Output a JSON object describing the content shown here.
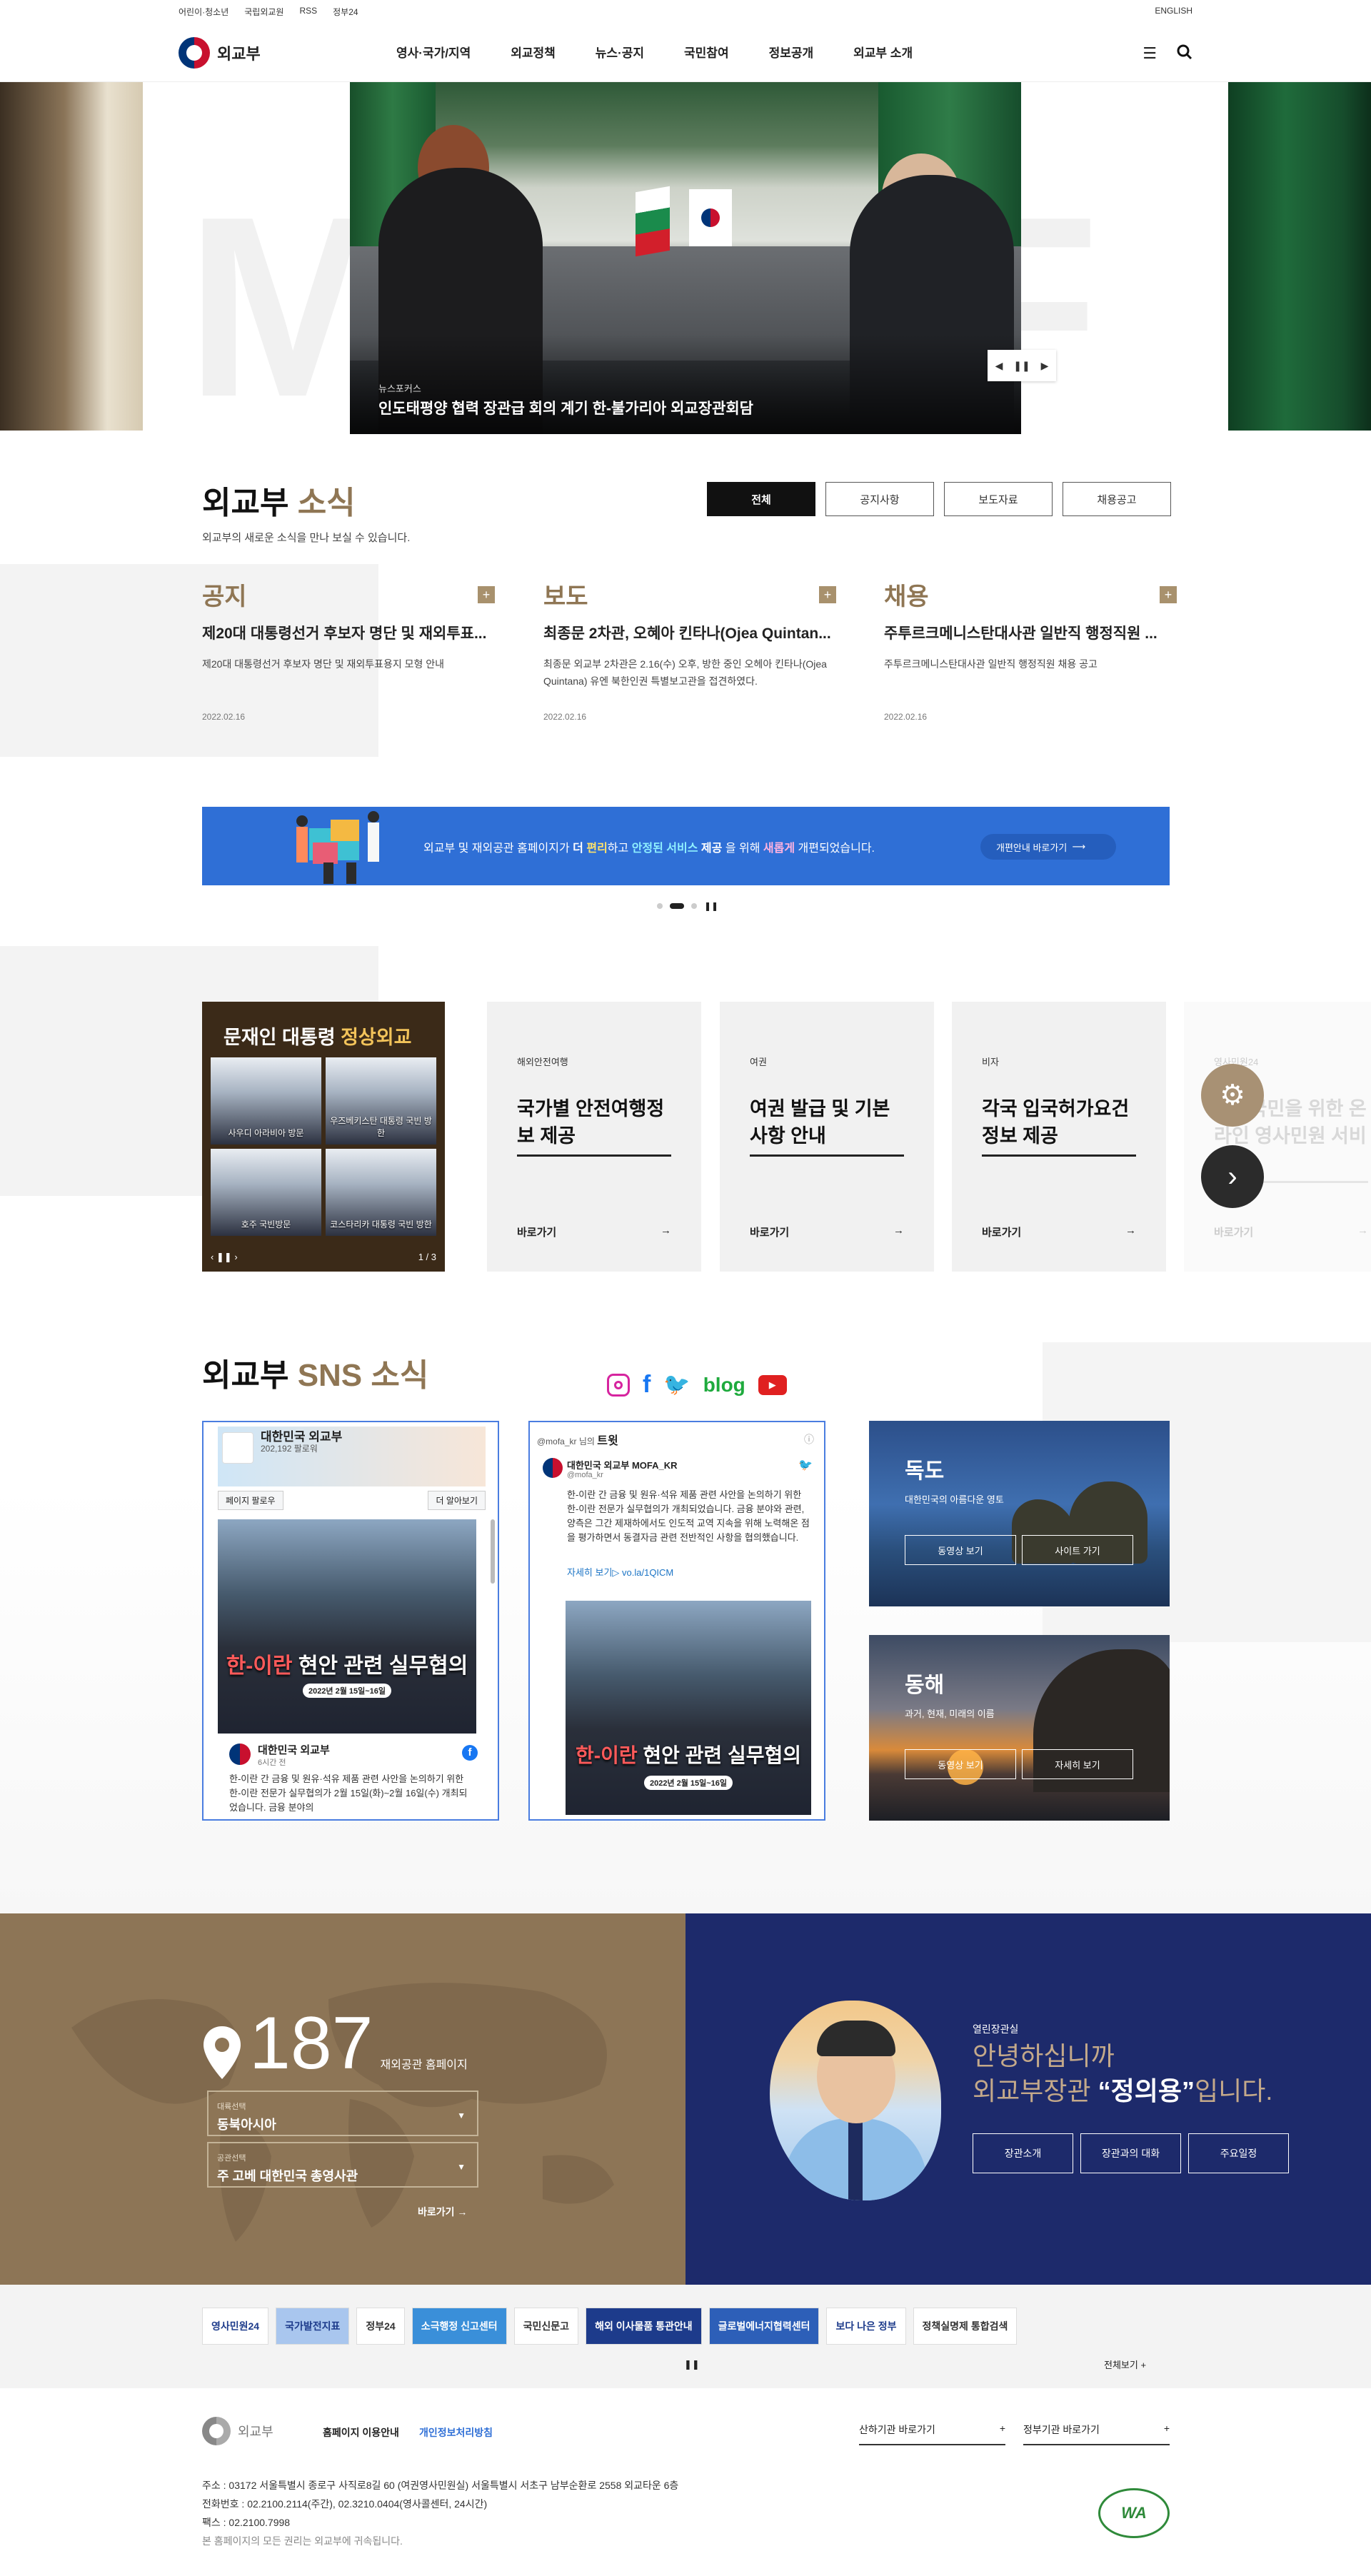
{
  "util": {
    "links": [
      "어린이·청소년",
      "국립외교원",
      "RSS",
      "정부24"
    ],
    "lang": "ENGLISH"
  },
  "header": {
    "logo_text": "외교부",
    "nav": [
      "영사·국가/지역",
      "외교정책",
      "뉴스·공지",
      "국민참여",
      "정보공개",
      "외교부 소개"
    ]
  },
  "hero": {
    "bg_text": "MOFA",
    "category": "뉴스포커스",
    "title": "인도태평양 협력 장관급 회의 계기 한-불가리아 외교장관회담"
  },
  "news": {
    "title": "외교부",
    "title_accent": "소식",
    "subtitle": "외교부의 새로운 소식을 만나 보실 수 있습니다.",
    "tabs": [
      "전체",
      "공지사항",
      "보도자료",
      "채용공고"
    ],
    "columns": [
      {
        "category": "공지",
        "title": "제20대 대통령선거 후보자 명단 및 재외투표...",
        "desc": "제20대 대통령선거 후보자 명단 및 재외투표용지 모형 안내",
        "date": "2022.02.16"
      },
      {
        "category": "보도",
        "title": "최종문 2차관, 오혜아 킨타나(Ojea Quintan...",
        "desc": "최종문 외교부 2차관은 2.16(수) 오후, 방한 중인 오헤아 킨타나(Ojea Quintana) 유엔 북한인권 특별보고관을 접견하였다.",
        "date": "2022.02.16"
      },
      {
        "category": "채용",
        "title": "주투르크메니스탄대사관 일반직 행정직원 ...",
        "desc": "주투르크메니스탄대사관 일반직 행정직원 채용 공고",
        "date": "2022.02.16"
      }
    ]
  },
  "banner": {
    "m1": "외교부 및 재외공관 홈페이지가",
    "m2": "더",
    "m3": "편리",
    "m4": "하고",
    "m5": "안정된 서비스",
    "m6": "제공",
    "m7": "을 위해",
    "m8": "새롭게",
    "m9": "개편되었습니다.",
    "button": "개편안내 바로가기"
  },
  "service": {
    "poster_title": "문재인 대통령",
    "poster_title_accent": "정상외교",
    "poster_photos": [
      "사우디 아라비아 방문",
      "우즈베키스탄 대통령 국빈 방한",
      "호주 국빈방문",
      "코스타리카 대통령 국빈 방한"
    ],
    "poster_page": "1 / 3",
    "cards": [
      {
        "category": "해외안전여행",
        "title": "국가별 안전여행정보 제공",
        "more": "바로가기"
      },
      {
        "category": "여권",
        "title": "여권 발급 및 기본사항 안내",
        "more": "바로가기"
      },
      {
        "category": "비자",
        "title": "각국 입국허가요건 정보 제공",
        "more": "바로가기"
      },
      {
        "category": "영사민원24",
        "title": "재외국민을 위한 온라인 영사민원 서비스",
        "more": "바로가기"
      }
    ]
  },
  "sns": {
    "title": "외교부",
    "title_accent": "SNS 소식",
    "icons": [
      "instagram-icon",
      "facebook-icon",
      "twitter-icon",
      "blog-icon",
      "youtube-icon"
    ],
    "blog_label": "blog",
    "facebook": {
      "page_name": "대한민국 외교부",
      "likes": "202,192 팔로워",
      "follow": "페이지 팔로우",
      "learn": "더 알아보기",
      "image_caption_a": "한-이란",
      "image_caption_b": "현안 관련 실무협의",
      "image_date": "2022년 2월 15일~16일",
      "post_author": "대한민국 외교부",
      "post_time": "6시간 전",
      "post_text": "한-이란 간 금융 및 원유·석유 제품 관련 사안을 논의하기 위한 한-이란 전문가 실무협의가 2월 15일(화)~2월 16일(수) 개최되었습니다. 금융 분야의"
    },
    "twitter": {
      "handle_tag": "@mofa_kr 님의",
      "label": "트윗",
      "author": "대한민국 외교부 MOFA_KR",
      "handle": "@mofa_kr",
      "text": "한-이란 간 금융 및 원유·석유 제품 관련 사안을 논의하기 위한 한-이란 전문가 실무협의가 개최되었습니다. 금융 분야와 관련, 양측은 그간 제재하에서도 인도적 교역 지속을 위해 노력해온 점을 평가하면서 동결자금 관련 전반적인 사항을 협의했습니다.",
      "link": "자세히 보기▷ vo.la/1QICM"
    },
    "places": [
      {
        "title": "독도",
        "sub": "대한민국의 아름다운 영토",
        "btn1": "동영상 보기",
        "btn2": "사이트 가기"
      },
      {
        "title": "동해",
        "sub": "과거, 현재, 미래의 이름",
        "btn1": "동영상 보기",
        "btn2": "자세히 보기"
      }
    ]
  },
  "mission": {
    "count": "187",
    "count_label": "재외공관 홈페이지",
    "region_label": "대륙선택",
    "region_value": "동북아시아",
    "office_label": "공관선택",
    "office_value": "주 고베 대한민국 총영사관",
    "go": "바로가기"
  },
  "minister": {
    "role": "열린장관실",
    "greet1": "안녕하십니까",
    "greet2a": "외교부장관",
    "greet2b": "“정의용”",
    "greet2c": "입니다.",
    "buttons": [
      "장관소개",
      "장관과의 대화",
      "주요일정"
    ]
  },
  "links": {
    "items": [
      "영사민원24",
      "국가발전지표",
      "정부24",
      "소극행정 신고센터",
      "국민신문고",
      "해외 이사물품 통관안내",
      "글로벌에너지협력센터",
      "보다 나은 정부",
      "정책실명제 통합검색"
    ],
    "all": "전체보기"
  },
  "footer": {
    "logo_text": "외교부",
    "links": [
      "홈페이지 이용안내",
      "개인정보처리방침"
    ],
    "select1": "산하기관 바로가기",
    "select2": "정부기관 바로가기",
    "address": "주소 : 03172 서울특별시 종로구 사직로8길 60 (여권영사민원실) 서울특별시 서초구 남부순환로 2558 외교타운 6층",
    "phone": "전화번호 : 02.2100.2114(주간), 02.3210.0404(영사콜센터, 24시간)",
    "fax": "팩스 : 02.2100.7998",
    "copyright": "본 홈페이지의 모든 권리는 외교부에 귀속됩니다.",
    "mark": "WA"
  }
}
